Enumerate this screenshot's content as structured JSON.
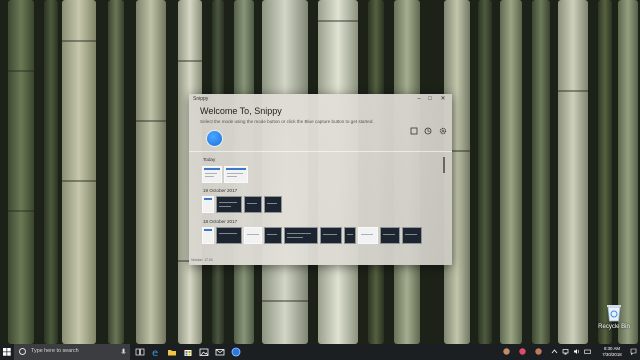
{
  "desktop": {
    "recycle_bin_label": "Recycle Bin"
  },
  "window": {
    "app_name": "Snippy",
    "title": "Welcome To, Snippy",
    "subtitle": "Select the mode using the mode button or click the Blue capture button to get started.",
    "controls": {
      "minimize": "–",
      "maximize": "□",
      "close": "✕"
    },
    "toolbar_icons": [
      "mode-square-icon",
      "history-clock-icon",
      "settings-gear-icon"
    ],
    "capture_button_color": "#1a6fe0",
    "groups": [
      {
        "label": "Today"
      },
      {
        "label": "19 October 2017"
      },
      {
        "label": "18 October 2017"
      }
    ],
    "version": "Version: 17.04"
  },
  "taskbar": {
    "search_placeholder": "Type here to search",
    "pinned_icons": [
      "task-view-icon",
      "edge-icon",
      "file-explorer-icon",
      "store-icon",
      "photos-icon",
      "mail-icon",
      "snippy-icon"
    ],
    "tray_icons": [
      "people-icon",
      "chevron-up-icon",
      "network-icon",
      "volume-icon",
      "keyboard-icon"
    ],
    "time": "8:30 AM",
    "date": "7/30/2018"
  }
}
